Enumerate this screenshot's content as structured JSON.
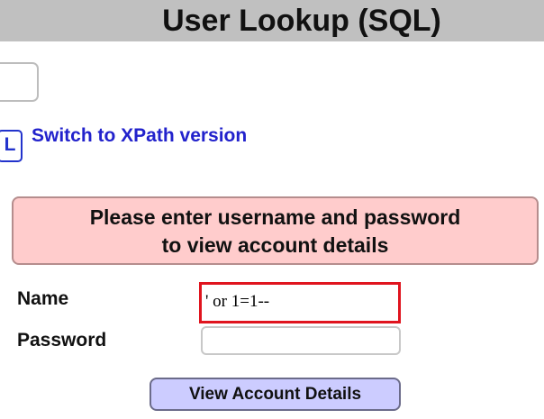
{
  "header": {
    "title": "User Lookup (SQL)"
  },
  "nav": {
    "icon_glyph": "L",
    "switch_link": "Switch to XPath version"
  },
  "message": {
    "line1": "Please enter username and password",
    "line2": "to view account details"
  },
  "form": {
    "name_label": "Name",
    "name_value": "' or 1=1--",
    "password_label": "Password",
    "password_value": "",
    "submit_label": "View Account Details"
  },
  "colors": {
    "title_bar_bg": "#c0c0c0",
    "message_bg": "#ffcccc",
    "highlight_border": "#e0141e",
    "button_bg": "#ccccff",
    "link": "#2222cc"
  }
}
